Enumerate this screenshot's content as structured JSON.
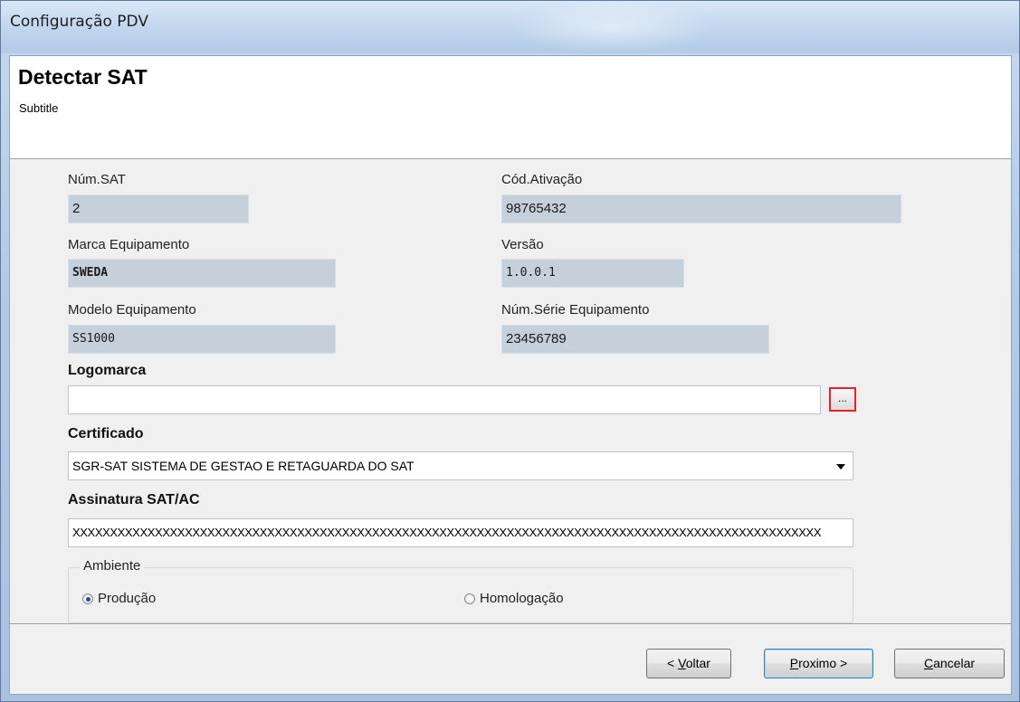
{
  "window": {
    "title": "Configuração PDV"
  },
  "header": {
    "title": "Detectar SAT",
    "subtitle": "Subtitle"
  },
  "fields": {
    "num_sat": {
      "label": "Núm.SAT",
      "value": "2"
    },
    "cod_ativacao": {
      "label": "Cód.Ativação",
      "value": "98765432"
    },
    "marca": {
      "label": "Marca Equipamento",
      "value": "SWEDA"
    },
    "versao": {
      "label": "Versão",
      "value": "1.0.0.1"
    },
    "modelo": {
      "label": "Modelo Equipamento",
      "value": "SS1000"
    },
    "num_serie": {
      "label": "Núm.Série Equipamento",
      "value": "23456789"
    },
    "logomarca": {
      "label": "Logomarca",
      "value": "",
      "browse_label": "..."
    },
    "certificado": {
      "label": "Certificado",
      "value": "SGR-SAT SISTEMA DE GESTAO E RETAGUARDA DO SAT"
    },
    "assinatura": {
      "label": "Assinatura SAT/AC",
      "value": "XXXXXXXXXXXXXXXXXXXXXXXXXXXXXXXXXXXXXXXXXXXXXXXXXXXXXXXXXXXXXXXXXXXXXXXXXXXXXXXXXXXXXXXXXXXXXXXXXXXX"
    }
  },
  "ambiente": {
    "legend": "Ambiente",
    "options": [
      {
        "label": "Produção",
        "checked": true
      },
      {
        "label": "Homologação",
        "checked": false
      }
    ]
  },
  "buttons": {
    "back": {
      "prefix": "< ",
      "mnemonic": "V",
      "rest": "oltar"
    },
    "next": {
      "mnemonic": "P",
      "rest": "roximo >"
    },
    "cancel": {
      "mnemonic": "C",
      "rest": "ancelar"
    }
  },
  "colors": {
    "highlight_border": "#e8202a",
    "readonly_bg": "#c6d0db"
  }
}
